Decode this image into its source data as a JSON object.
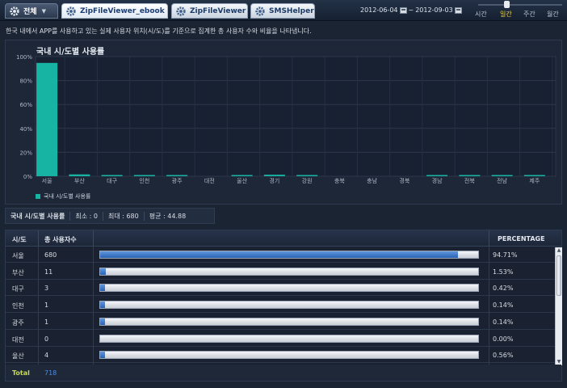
{
  "tabs": [
    {
      "label": "전체",
      "icon": "gear-icon",
      "has_dropdown": true
    },
    {
      "label": "ZipFileViewer_ebook",
      "icon": "gear-icon",
      "active": true
    },
    {
      "label": "ZipFileViewer",
      "icon": "gear-icon"
    },
    {
      "label": "SMSHelper",
      "icon": "gear-icon"
    }
  ],
  "date_range": {
    "start": "2012-06-04",
    "separator": "~",
    "end": "2012-09-03"
  },
  "periods": [
    {
      "label": "시간"
    },
    {
      "label": "일간",
      "active": true
    },
    {
      "label": "주간"
    },
    {
      "label": "월간"
    }
  ],
  "description": "한국 내에서 APP를 사용하고 있는 실제 사용자 위치(시/도)를 기준으로 집계한 총 사용자 수와 비율을 나타냅니다.",
  "chart_data": {
    "type": "bar",
    "title": "국내 시/도별 사용률",
    "categories": [
      "서울",
      "부산",
      "대구",
      "인천",
      "광주",
      "대전",
      "울산",
      "경기",
      "강원",
      "충북",
      "충남",
      "경북",
      "경남",
      "전북",
      "전남",
      "제주"
    ],
    "series": [
      {
        "name": "국내 시/도별 사용률",
        "values": [
          94.71,
          1.53,
          0.42,
          0.14,
          0.14,
          0.0,
          0.56,
          1.25,
          0.42,
          0.0,
          0.0,
          0.0,
          0.42,
          0.28,
          0.14,
          0.14
        ]
      }
    ],
    "ylim": [
      0,
      100
    ],
    "yticks": [
      "0%",
      "20%",
      "40%",
      "60%",
      "80%",
      "100%"
    ],
    "grid": true,
    "legend_position": "bottom-left",
    "bar_color": "#18b4a3"
  },
  "summary": {
    "title": "국내 시/도별 사용률",
    "min_label": "최소 : 0",
    "max_label": "최대 : 680",
    "avg_label": "평균 : 44.88"
  },
  "table": {
    "headers": {
      "region": "시/도",
      "count": "총 사용자수",
      "percentage": "PERCENTAGE"
    },
    "rows": [
      {
        "region": "서울",
        "count": "680",
        "percentage": "94.71%",
        "ratio": 0.9471
      },
      {
        "region": "부산",
        "count": "11",
        "percentage": "1.53%",
        "ratio": 0.0153
      },
      {
        "region": "대구",
        "count": "3",
        "percentage": "0.42%",
        "ratio": 0.0042
      },
      {
        "region": "인천",
        "count": "1",
        "percentage": "0.14%",
        "ratio": 0.0014
      },
      {
        "region": "광주",
        "count": "1",
        "percentage": "0.14%",
        "ratio": 0.0014
      },
      {
        "region": "대전",
        "count": "0",
        "percentage": "0.00%",
        "ratio": 0.0
      },
      {
        "region": "울산",
        "count": "4",
        "percentage": "0.56%",
        "ratio": 0.0056
      }
    ],
    "total_label": "Total",
    "total_value": "718"
  },
  "colors": {
    "bar": "#18b4a3",
    "progress": "#2a62b4",
    "total_label": "#c7d95a",
    "total_value": "#4d8be0",
    "active_period": "#f0d23a"
  }
}
